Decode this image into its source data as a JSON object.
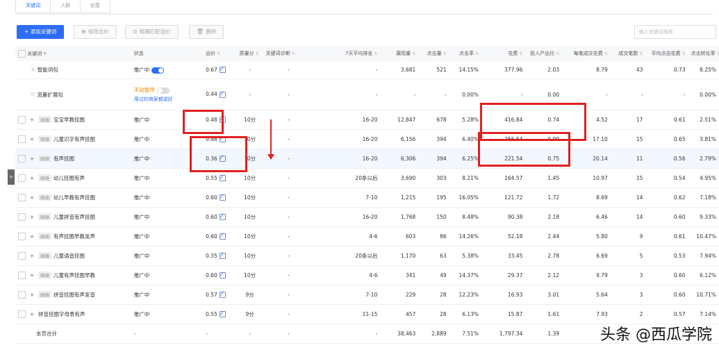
{
  "tabs": [
    "关键词",
    "人群",
    "创意"
  ],
  "toolbar": {
    "add_label": "+ 添加关键词",
    "modify_bid_label": "修改出价",
    "smart_bid_label": "精确匹配溢价",
    "delete_label": "删除",
    "search_placeholder": "输入关键词搜索"
  },
  "headers": [
    "关键词",
    "状态",
    "出价",
    "质量分",
    "关键词诊断",
    "7天平均排名",
    "展现量",
    "点击量",
    "点击率",
    "花费",
    "投入产出比",
    "每笔成交花费",
    "成交笔数",
    "平均点击花费",
    "点击转化率"
  ],
  "rows": [
    {
      "kw": "智能词包",
      "tag": "",
      "status": "推广中",
      "bid": "0.67",
      "q": "-",
      "diag": "-",
      "rank": "-",
      "imp": "3,681",
      "clk": "521",
      "ctr": "14.15%",
      "cost": "377.96",
      "roi": "2.03",
      "cpo": "8.79",
      "orders": "43",
      "cpc": "0.73",
      "cvr": "8.25%"
    },
    {
      "kw": "流量扩展包",
      "tag": "",
      "status": "手动暂停",
      "status2": "用过的商家都说好",
      "bid": "0.44",
      "q": "-",
      "diag": "-",
      "rank": "-",
      "imp": "-",
      "clk": "-",
      "ctr": "0.00%",
      "cost": "-",
      "roi": "0.00",
      "cpo": "-",
      "orders": "-",
      "cpc": "-",
      "cvr": "0.00%"
    },
    {
      "kw": "宝宝早教挂图",
      "tag": "精确",
      "status": "推广中",
      "bid": "0.48",
      "q": "10分",
      "diag": "-",
      "rank": "16-20",
      "imp": "12,847",
      "clk": "678",
      "ctr": "5.28%",
      "cost": "416.84",
      "roi": "0.74",
      "cpo": "4.52",
      "orders": "17",
      "cpc": "0.61",
      "cvr": "2.51%"
    },
    {
      "kw": "儿童识字有声挂图",
      "tag": "精确",
      "status": "推广中",
      "bid": "0.48",
      "q": "10分",
      "diag": "-",
      "rank": "16-20",
      "imp": "6,156",
      "clk": "394",
      "ctr": "6.40%",
      "cost": "256.54",
      "roi": "0.99",
      "cpo": "17.10",
      "orders": "15",
      "cpc": "0.65",
      "cvr": "3.81%"
    },
    {
      "kw": "有声挂图",
      "tag": "精确",
      "status": "推广中",
      "bid": "0.36",
      "q": "10分",
      "diag": "-",
      "rank": "16-20",
      "imp": "6,306",
      "clk": "394",
      "ctr": "6.25%",
      "cost": "221.54",
      "roi": "0.75",
      "cpo": "20.14",
      "orders": "11",
      "cpc": "0.56",
      "cvr": "2.79%"
    },
    {
      "kw": "幼儿挂图有声",
      "tag": "精确",
      "status": "推广中",
      "bid": "0.55",
      "q": "10分",
      "diag": "-",
      "rank": "20条以后",
      "imp": "3,690",
      "clk": "303",
      "ctr": "8.21%",
      "cost": "164.57",
      "roi": "1.45",
      "cpo": "10.97",
      "orders": "15",
      "cpc": "0.54",
      "cvr": "4.95%"
    },
    {
      "kw": "幼儿早教有声挂图",
      "tag": "精确",
      "status": "推广中",
      "bid": "0.60",
      "q": "10分",
      "diag": "-",
      "rank": "7-10",
      "imp": "1,215",
      "clk": "195",
      "ctr": "16.05%",
      "cost": "121.72",
      "roi": "1.72",
      "cpo": "8.69",
      "orders": "14",
      "cpc": "0.62",
      "cvr": "7.18%"
    },
    {
      "kw": "儿童拼音有声挂图",
      "tag": "精确",
      "status": "推广中",
      "bid": "0.60",
      "q": "10分",
      "diag": "-",
      "rank": "16-20",
      "imp": "1,768",
      "clk": "150",
      "ctr": "8.48%",
      "cost": "90.38",
      "roi": "2.18",
      "cpo": "6.46",
      "orders": "14",
      "cpc": "0.60",
      "cvr": "9.33%"
    },
    {
      "kw": "有声挂图早教发声",
      "tag": "精确",
      "status": "推广中",
      "bid": "0.60",
      "q": "10分",
      "diag": "-",
      "rank": "4-6",
      "imp": "603",
      "clk": "86",
      "ctr": "14.26%",
      "cost": "52.18",
      "roi": "2.44",
      "cpo": "5.80",
      "orders": "9",
      "cpc": "0.61",
      "cvr": "10.47%"
    },
    {
      "kw": "儿童语音挂图",
      "tag": "精确",
      "status": "推广中",
      "bid": "0.35",
      "q": "10分",
      "diag": "-",
      "rank": "20条以后",
      "imp": "1,170",
      "clk": "63",
      "ctr": "5.38%",
      "cost": "33.45",
      "roi": "2.78",
      "cpo": "6.69",
      "orders": "5",
      "cpc": "0.53",
      "cvr": "7.94%"
    },
    {
      "kw": "儿童有声挂图早教",
      "tag": "精确",
      "status": "推广中",
      "bid": "0.60",
      "q": "10分",
      "diag": "-",
      "rank": "4-6",
      "imp": "341",
      "clk": "49",
      "ctr": "14.37%",
      "cost": "29.37",
      "roi": "2.12",
      "cpo": "9.79",
      "orders": "3",
      "cpc": "0.60",
      "cvr": "6.12%"
    },
    {
      "kw": "拼音挂图有声发音",
      "tag": "精确",
      "status": "推广中",
      "bid": "0.57",
      "q": "9分",
      "diag": "-",
      "rank": "7-10",
      "imp": "229",
      "clk": "28",
      "ctr": "12.23%",
      "cost": "16.93",
      "roi": "3.01",
      "cpo": "5.64",
      "orders": "3",
      "cpc": "0.60",
      "cvr": "10.71%"
    },
    {
      "kw": "拼音挂图字母表有声",
      "tag": "",
      "status": "推广中",
      "bid": "0.55",
      "q": "9分",
      "diag": "-",
      "rank": "11-15",
      "imp": "457",
      "clk": "28",
      "ctr": "6.13%",
      "cost": "15.87",
      "roi": "1.61",
      "cpo": "7.93",
      "orders": "2",
      "cpc": "0.57",
      "cvr": "7.14%"
    }
  ],
  "total": {
    "label": "本页合计",
    "status": "-",
    "bid": "-",
    "q": "-",
    "diag": "-",
    "rank": "-",
    "imp": "38,463",
    "clk": "2,889",
    "ctr": "7.51%",
    "cost": "1,797.34",
    "roi": "1.39",
    "cpo": "",
    "orders": "",
    "cpc": "",
    "cvr": ""
  },
  "watermark": "头条 @西瓜学院",
  "accent": "#2d6cf6",
  "highlight_color": "#e02020"
}
